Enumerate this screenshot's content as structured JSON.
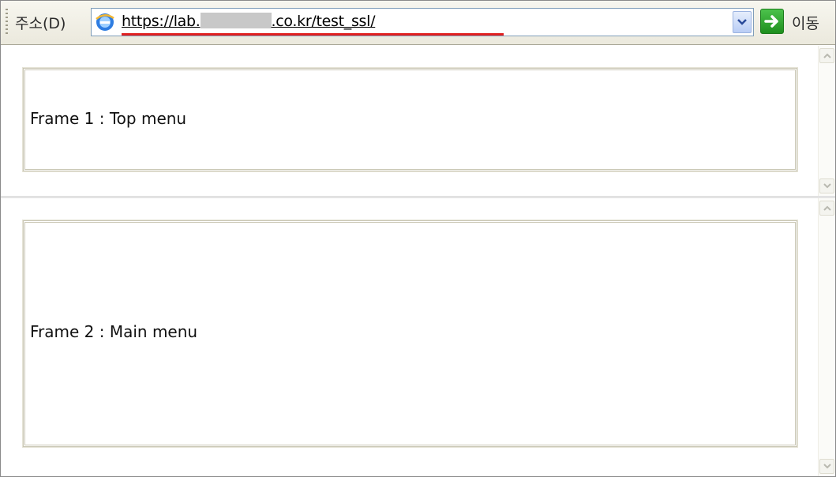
{
  "address_bar": {
    "label": "주소(D)",
    "url_prefix": "https://lab.",
    "url_suffix": ".co.kr/test_ssl/",
    "go_label": "이동"
  },
  "frames": [
    {
      "text": "Frame 1 : Top menu"
    },
    {
      "text": "Frame 2 : Main menu"
    }
  ],
  "icons": {
    "browser": "ie-icon",
    "dropdown": "chevron-down-icon",
    "go": "arrow-right-icon",
    "scroll_up": "chevron-up-icon",
    "scroll_down": "chevron-down-icon"
  },
  "colors": {
    "url_underline": "#e02020",
    "go_button": "#2aa52a"
  }
}
